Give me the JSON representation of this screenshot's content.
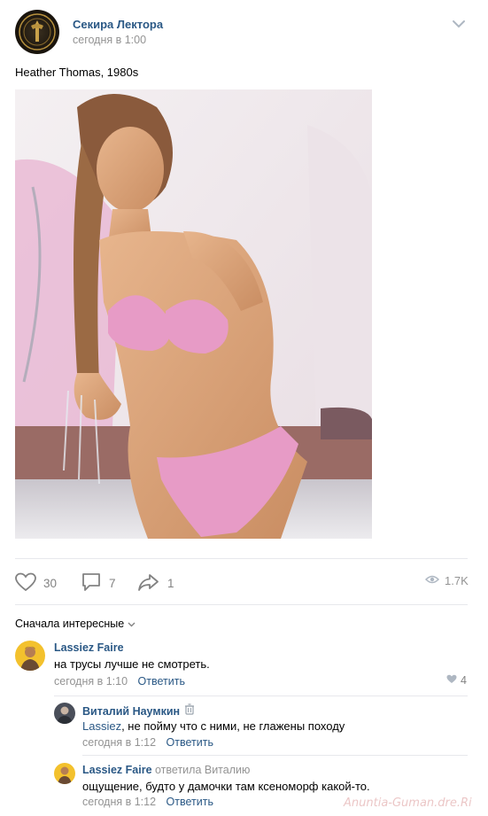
{
  "post": {
    "author": "Секира Лектора",
    "time": "сегодня в 1:00",
    "text": "Heather Thomas, 1980s"
  },
  "actions": {
    "likes": "30",
    "comments": "7",
    "shares": "1",
    "views": "1.7K"
  },
  "comments_header": {
    "sort_label": "Сначала интересные"
  },
  "comments": [
    {
      "author": "Lassiez Faire",
      "text": "на трусы лучше не смотреть.",
      "time": "сегодня в 1:10",
      "reply_label": "Ответить",
      "likes": "4"
    },
    {
      "author": "Виталий Наумкин",
      "mention": "Lassiez",
      "text": ", не пойму что с ними, не глажены походу",
      "time": "сегодня в 1:12",
      "reply_label": "Ответить"
    },
    {
      "author": "Lassiez Faire",
      "replied_to": "ответила Виталию",
      "text": "ощущение, будто у дамочки там ксеноморф какой-то.",
      "time": "сегодня в 1:12",
      "reply_label": "Ответить"
    }
  ],
  "watermark": "Anuntia-Guman.dre.Ri",
  "icons": {
    "post_menu": "chevron-down-icon",
    "like": "heart-icon",
    "comment": "comment-bubble-icon",
    "share": "share-arrow-icon",
    "views": "eye-icon",
    "badge": "trash-icon"
  },
  "colors": {
    "link": "#2a5885",
    "muted": "#939393",
    "icon": "#828282"
  }
}
